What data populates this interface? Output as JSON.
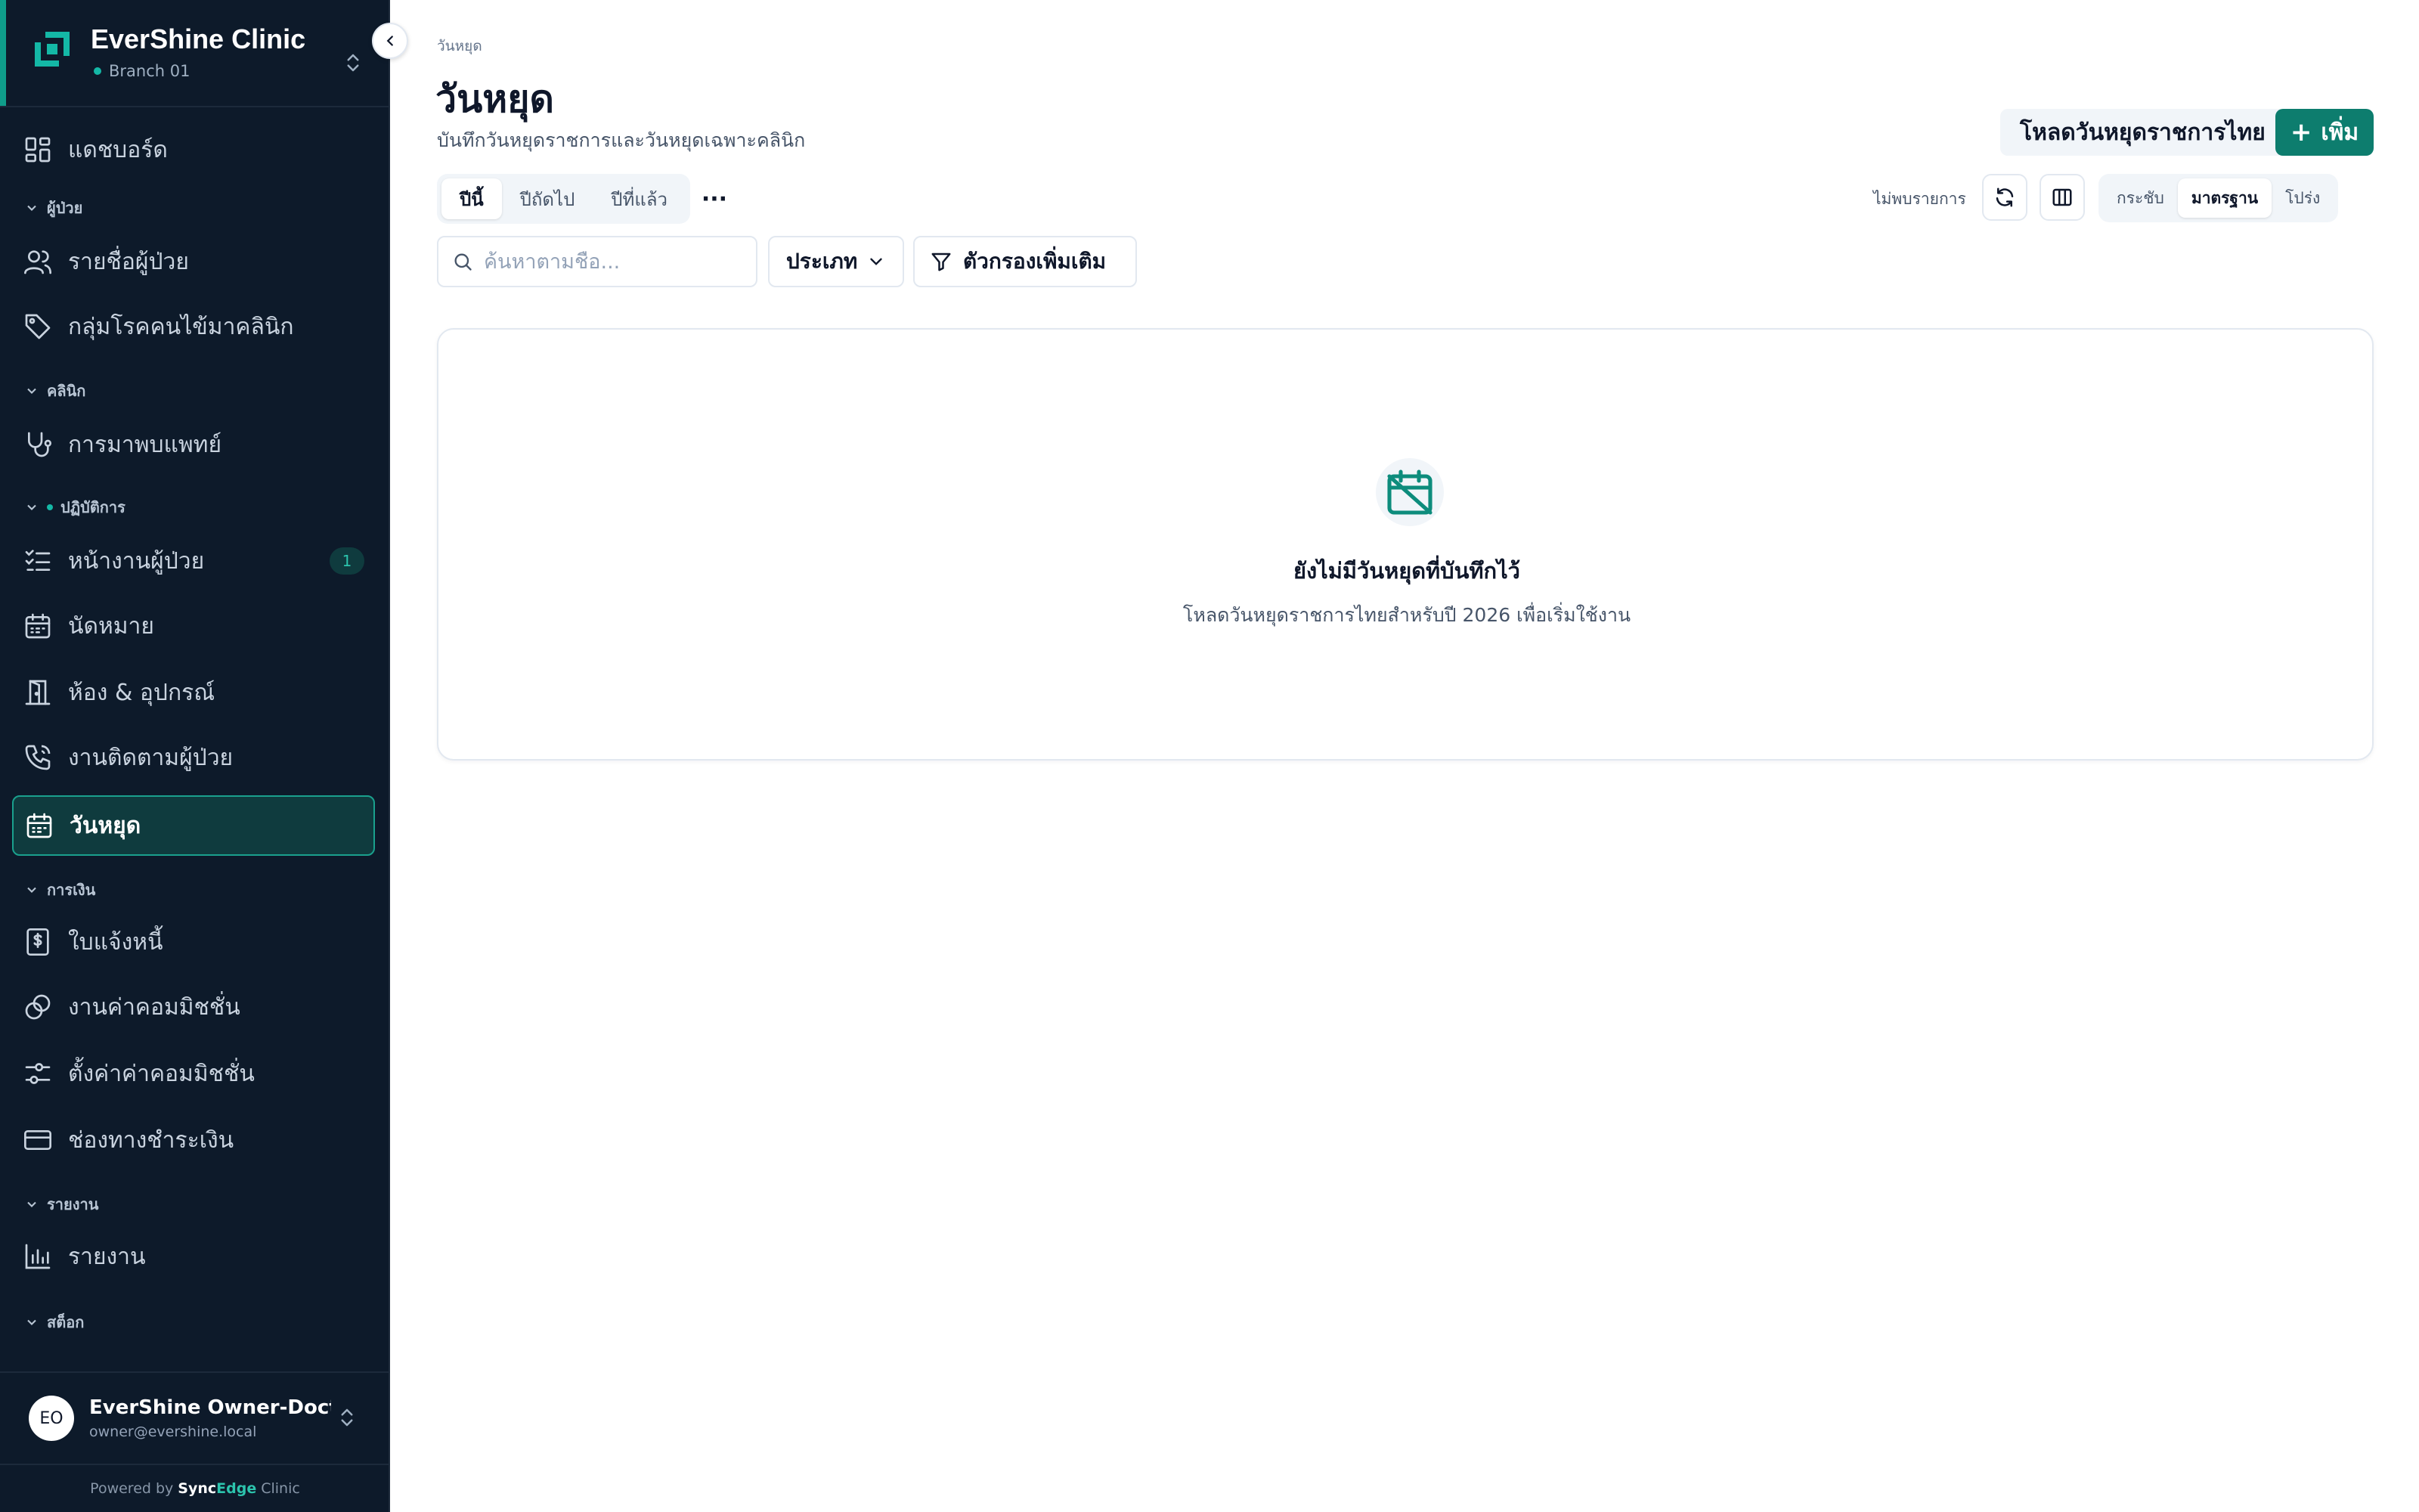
{
  "sidebar": {
    "brand": {
      "name": "EverShine Clinic",
      "branch": "Branch 01"
    },
    "nav": {
      "dashboard": "แดชบอร์ด",
      "section_patients": "ผู้ป่วย",
      "patient_list": "รายชื่อผู้ป่วย",
      "disease_groups": "กลุ่มโรคคนไข้มาคลินิก",
      "section_clinic": "คลินิก",
      "doctor_visits": "การมาพบแพทย์",
      "section_operations": "ปฏิบัติการ",
      "patient_tasks": "หน้างานผู้ป่วย",
      "patient_tasks_badge": "1",
      "appointments": "นัดหมาย",
      "rooms_equipment": "ห้อง & อุปกรณ์",
      "patient_followup": "งานติดตามผู้ป่วย",
      "holidays": "วันหยุด",
      "section_finance": "การเงิน",
      "invoices": "ใบแจ้งหนี้",
      "commission_tasks": "งานค่าคอมมิชชั่น",
      "commission_settings": "ตั้งค่าค่าคอมมิชชั่น",
      "payment_channels": "ช่องทางชำระเงิน",
      "section_reports": "รายงาน",
      "reports": "รายงาน",
      "section_stock": "สต็อก"
    },
    "user": {
      "initials": "EO",
      "name": "EverShine Owner-Doctor",
      "email": "owner@evershine.local"
    },
    "powered": {
      "prefix": "Powered by",
      "brand_a": "Sync",
      "brand_b": "Edge",
      "brand_c": "Clinic"
    }
  },
  "header": {
    "breadcrumb": "วันหยุด",
    "title": "วันหยุด",
    "subtitle": "บันทึกวันหยุดราชการและวันหยุดเฉพาะคลินิก",
    "load_button": "โหลดวันหยุดราชการไทย",
    "add_button": "เพิ่ม"
  },
  "toolbar": {
    "tabs": [
      "ปีนี้",
      "ปีถัดไป",
      "ปีที่แล้ว"
    ],
    "more": "···",
    "status": "ไม่พบรายการ",
    "density": [
      "กระชับ",
      "มาตรฐาน",
      "โปร่ง"
    ],
    "density_selected": "มาตรฐาน"
  },
  "filters": {
    "search_placeholder": "ค้นหาตามชื่อ...",
    "type_label": "ประเภท",
    "more_filters": "ตัวกรองเพิ่มเติม"
  },
  "empty": {
    "title": "ยังไม่มีวันหยุดที่บันทึกไว้",
    "description": "โหลดวันหยุดราชการไทยสำหรับปี 2026 เพื่อเริ่มใช้งาน"
  },
  "colors": {
    "sidebar_bg": "#0d1a2a",
    "accent": "#0d7d6e",
    "active_bg": "#0f3b3e"
  }
}
